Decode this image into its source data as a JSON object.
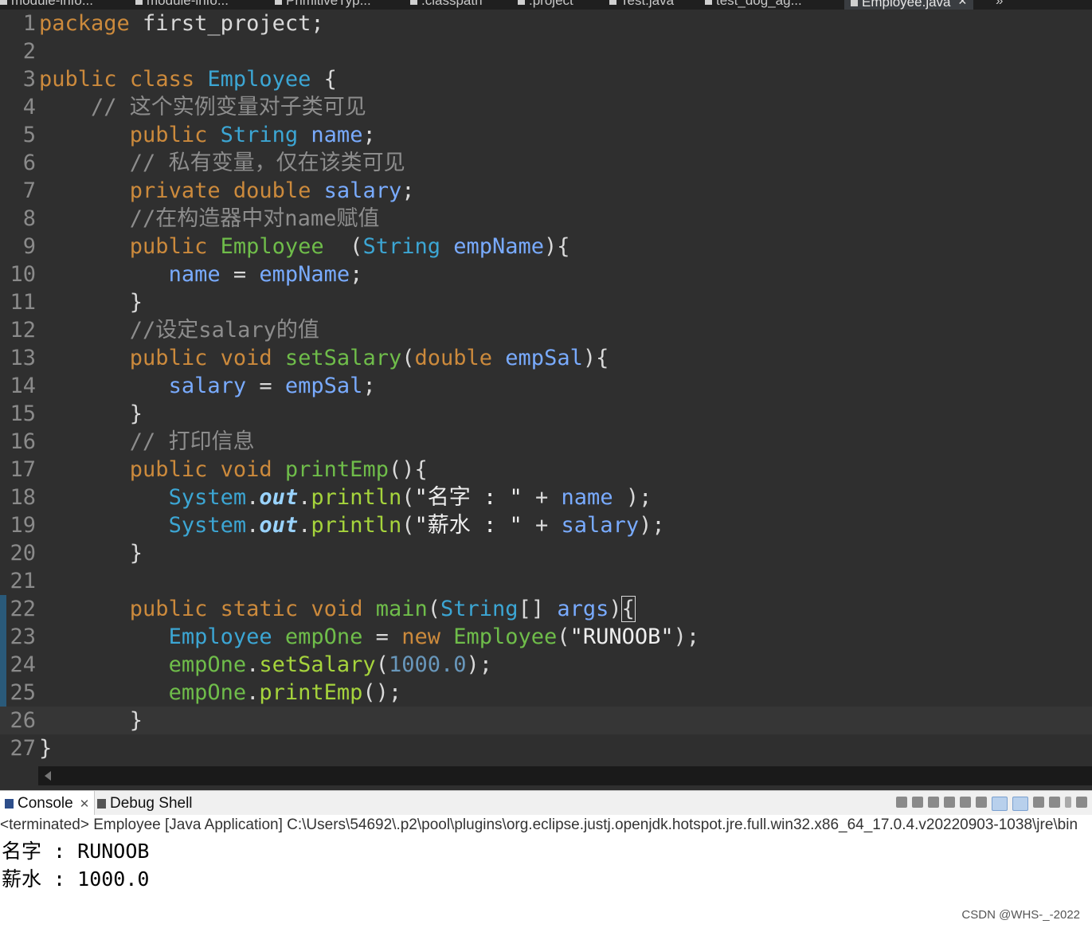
{
  "tabs": [
    {
      "label": "module-info...",
      "active": false
    },
    {
      "label": "module-info...",
      "active": false
    },
    {
      "label": "PrimitiveTyp...",
      "active": false
    },
    {
      "label": ".classpath",
      "active": false
    },
    {
      "label": ".project",
      "active": false
    },
    {
      "label": "Test.java",
      "active": false
    },
    {
      "label": "test_dog_ag...",
      "active": false
    },
    {
      "label": "Employee.java",
      "active": true
    }
  ],
  "tab_close": "✕",
  "tab_overflow": "»",
  "editor": {
    "current_line": 26,
    "lines": [
      {
        "n": "1",
        "tokens": [
          [
            "kw",
            "package"
          ],
          [
            "p",
            " first_project;"
          ]
        ]
      },
      {
        "n": "2",
        "tokens": []
      },
      {
        "n": "3",
        "tokens": [
          [
            "kw",
            "public"
          ],
          [
            "p",
            " "
          ],
          [
            "kw",
            "class"
          ],
          [
            "p",
            " "
          ],
          [
            "cls",
            "Employee"
          ],
          [
            "p",
            " {"
          ]
        ]
      },
      {
        "n": "4",
        "tokens": [
          [
            "p",
            "    "
          ],
          [
            "com",
            "// 这个实例变量对子类可见"
          ]
        ]
      },
      {
        "n": "5",
        "tokens": [
          [
            "p",
            "       "
          ],
          [
            "kw",
            "public"
          ],
          [
            "p",
            " "
          ],
          [
            "ty",
            "String"
          ],
          [
            "p",
            " "
          ],
          [
            "var",
            "name"
          ],
          [
            "p",
            ";"
          ]
        ]
      },
      {
        "n": "6",
        "tokens": [
          [
            "p",
            "       "
          ],
          [
            "com",
            "// 私有变量，仅在该类可见"
          ]
        ]
      },
      {
        "n": "7",
        "tokens": [
          [
            "p",
            "       "
          ],
          [
            "kw",
            "private"
          ],
          [
            "p",
            " "
          ],
          [
            "kw",
            "double"
          ],
          [
            "p",
            " "
          ],
          [
            "var",
            "salary"
          ],
          [
            "p",
            ";"
          ]
        ]
      },
      {
        "n": "8",
        "tokens": [
          [
            "p",
            "       "
          ],
          [
            "com",
            "//在构造器中对name赋值"
          ]
        ]
      },
      {
        "n": "9",
        "tokens": [
          [
            "p",
            "       "
          ],
          [
            "kw",
            "public"
          ],
          [
            "p",
            " "
          ],
          [
            "fn",
            "Employee"
          ],
          [
            "p",
            "  ("
          ],
          [
            "ty",
            "String"
          ],
          [
            "p",
            " "
          ],
          [
            "var",
            "empName"
          ],
          [
            "p",
            "){"
          ]
        ]
      },
      {
        "n": "10",
        "tokens": [
          [
            "p",
            "          "
          ],
          [
            "var",
            "name"
          ],
          [
            "p",
            " = "
          ],
          [
            "var",
            "empName"
          ],
          [
            "p",
            ";"
          ]
        ]
      },
      {
        "n": "11",
        "tokens": [
          [
            "p",
            "       }"
          ]
        ]
      },
      {
        "n": "12",
        "tokens": [
          [
            "p",
            "       "
          ],
          [
            "com",
            "//设定salary的值"
          ]
        ]
      },
      {
        "n": "13",
        "tokens": [
          [
            "p",
            "       "
          ],
          [
            "kw",
            "public"
          ],
          [
            "p",
            " "
          ],
          [
            "kw",
            "void"
          ],
          [
            "p",
            " "
          ],
          [
            "fn",
            "setSalary"
          ],
          [
            "p",
            "("
          ],
          [
            "kw",
            "double"
          ],
          [
            "p",
            " "
          ],
          [
            "var",
            "empSal"
          ],
          [
            "p",
            "){"
          ]
        ]
      },
      {
        "n": "14",
        "tokens": [
          [
            "p",
            "          "
          ],
          [
            "var",
            "salary"
          ],
          [
            "p",
            " = "
          ],
          [
            "var",
            "empSal"
          ],
          [
            "p",
            ";"
          ]
        ]
      },
      {
        "n": "15",
        "tokens": [
          [
            "p",
            "       }"
          ]
        ]
      },
      {
        "n": "16",
        "tokens": [
          [
            "p",
            "       "
          ],
          [
            "com",
            "// 打印信息"
          ]
        ]
      },
      {
        "n": "17",
        "tokens": [
          [
            "p",
            "       "
          ],
          [
            "kw",
            "public"
          ],
          [
            "p",
            " "
          ],
          [
            "kw",
            "void"
          ],
          [
            "p",
            " "
          ],
          [
            "fn",
            "printEmp"
          ],
          [
            "p",
            "(){"
          ]
        ]
      },
      {
        "n": "18",
        "tokens": [
          [
            "p",
            "          "
          ],
          [
            "ty",
            "System"
          ],
          [
            "p",
            "."
          ],
          [
            "field",
            "out"
          ],
          [
            "p",
            "."
          ],
          [
            "call",
            "println"
          ],
          [
            "p",
            "("
          ],
          [
            "str",
            "\"名字 : \""
          ],
          [
            "p",
            " + "
          ],
          [
            "var",
            "name"
          ],
          [
            "p",
            " );"
          ]
        ]
      },
      {
        "n": "19",
        "tokens": [
          [
            "p",
            "          "
          ],
          [
            "ty",
            "System"
          ],
          [
            "p",
            "."
          ],
          [
            "field",
            "out"
          ],
          [
            "p",
            "."
          ],
          [
            "call",
            "println"
          ],
          [
            "p",
            "("
          ],
          [
            "str",
            "\"薪水 : \""
          ],
          [
            "p",
            " + "
          ],
          [
            "var",
            "salary"
          ],
          [
            "p",
            ");"
          ]
        ]
      },
      {
        "n": "20",
        "tokens": [
          [
            "p",
            "       }"
          ]
        ]
      },
      {
        "n": "21",
        "tokens": []
      },
      {
        "n": "22",
        "tokens": [
          [
            "p",
            "       "
          ],
          [
            "kw",
            "public"
          ],
          [
            "p",
            " "
          ],
          [
            "kw",
            "static"
          ],
          [
            "p",
            " "
          ],
          [
            "kw",
            "void"
          ],
          [
            "p",
            " "
          ],
          [
            "fn",
            "main"
          ],
          [
            "p",
            "("
          ],
          [
            "ty",
            "String"
          ],
          [
            "p",
            "[] "
          ],
          [
            "var",
            "args"
          ],
          [
            "p",
            ")"
          ],
          [
            "box",
            "{"
          ]
        ]
      },
      {
        "n": "23",
        "tokens": [
          [
            "p",
            "          "
          ],
          [
            "ty",
            "Employee"
          ],
          [
            "p",
            " "
          ],
          [
            "var2",
            "empOne"
          ],
          [
            "p",
            " = "
          ],
          [
            "kw",
            "new"
          ],
          [
            "p",
            " "
          ],
          [
            "fn",
            "Employee"
          ],
          [
            "p",
            "("
          ],
          [
            "str",
            "\"RUNOOB\""
          ],
          [
            "p",
            ");"
          ]
        ]
      },
      {
        "n": "24",
        "tokens": [
          [
            "p",
            "          "
          ],
          [
            "var2",
            "empOne"
          ],
          [
            "p",
            "."
          ],
          [
            "call",
            "setSalary"
          ],
          [
            "p",
            "("
          ],
          [
            "num",
            "1000.0"
          ],
          [
            "p",
            ");"
          ]
        ]
      },
      {
        "n": "25",
        "tokens": [
          [
            "p",
            "          "
          ],
          [
            "var2",
            "empOne"
          ],
          [
            "p",
            "."
          ],
          [
            "call",
            "printEmp"
          ],
          [
            "p",
            "();"
          ]
        ]
      },
      {
        "n": "26",
        "tokens": [
          [
            "p",
            "       }"
          ]
        ]
      },
      {
        "n": "27",
        "tokens": [
          [
            "p",
            "}"
          ]
        ]
      }
    ]
  },
  "console": {
    "tabs": [
      {
        "label": "Console",
        "active": true
      },
      {
        "label": "Debug Shell",
        "active": false
      }
    ],
    "status": "<terminated> Employee [Java Application] C:\\Users\\54692\\.p2\\pool\\plugins\\org.eclipse.justj.openjdk.hotspot.jre.full.win32.x86_64_17.0.4.v20220903-1038\\jre\\bin",
    "output": [
      "名字 : RUNOOB",
      "薪水 : 1000.0"
    ]
  },
  "watermark": "CSDN @WHS-_-2022"
}
